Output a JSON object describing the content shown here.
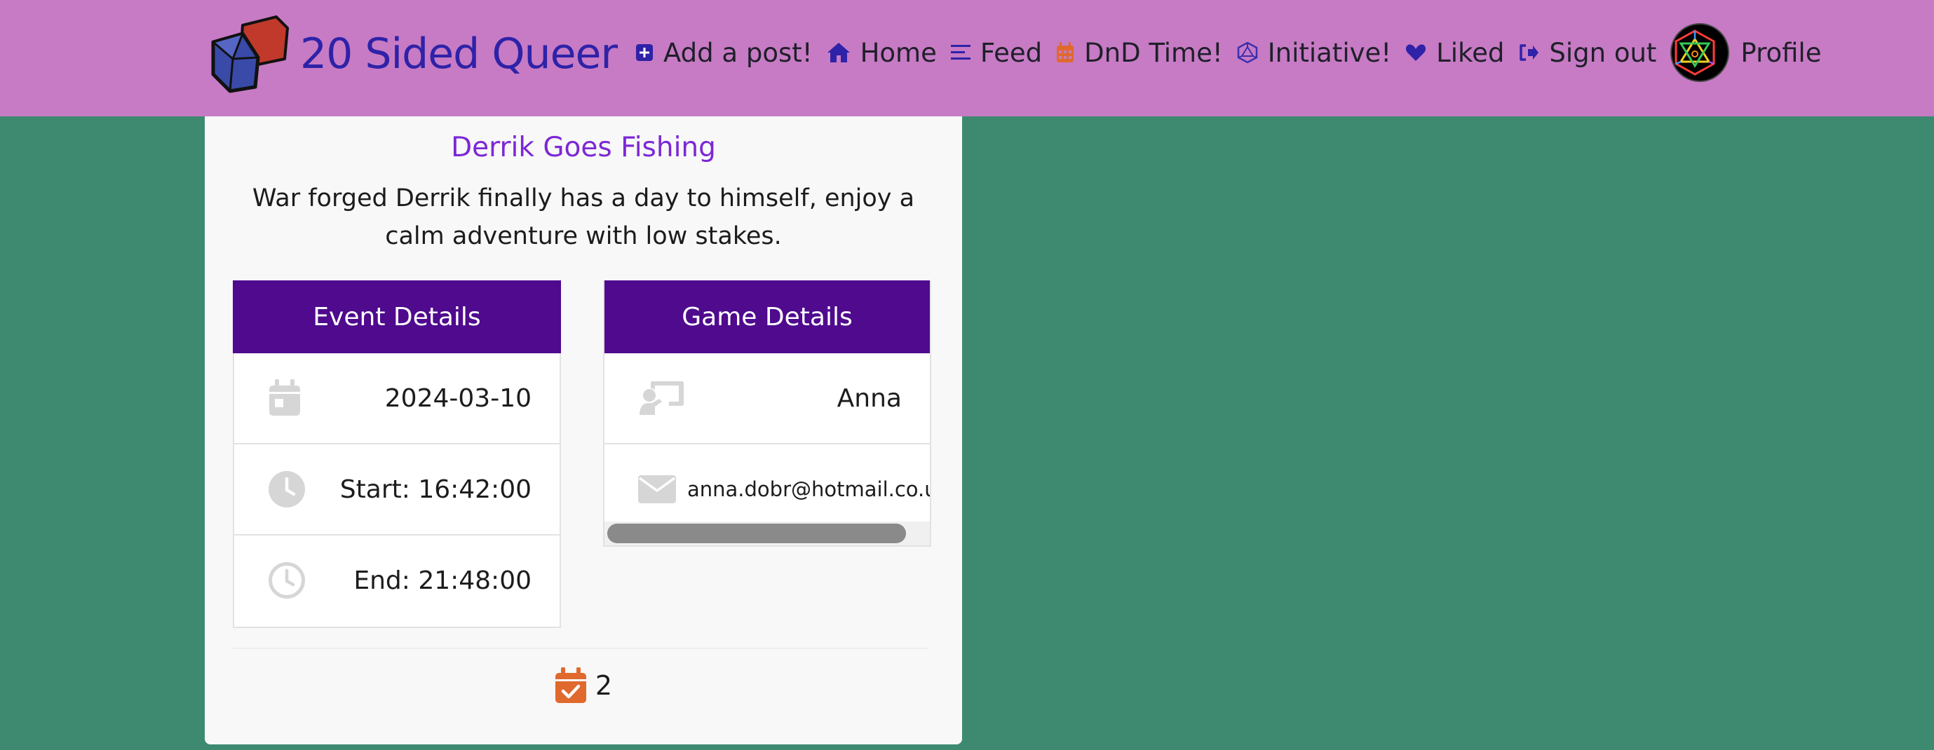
{
  "brand": {
    "name": "20 Sided Queer"
  },
  "nav": {
    "add_post": "Add a post!",
    "home": "Home",
    "feed": "Feed",
    "dnd_time": "DnD Time!",
    "initiative": "Initiative!",
    "liked": "Liked",
    "sign_out": "Sign out",
    "profile": "Profile"
  },
  "icons": {
    "add": "plus-square-icon",
    "home": "house-icon",
    "feed": "list-icon",
    "dnd": "calendar-icon",
    "initiative": "d20-icon",
    "liked": "heart-icon",
    "signout": "sign-out-icon"
  },
  "colors": {
    "navbar": "#c77bc4",
    "brand_text": "#2e22a8",
    "background": "#3d8a70",
    "panel_header": "#4f0a8e",
    "title": "#7d27d6",
    "accent_orange": "#e0692e"
  },
  "event": {
    "title": "Derrik Goes Fishing",
    "description": "War forged Derrik finally has a day to himself, enjoy a calm adventure with low stakes.",
    "details_header": "Event Details",
    "date": "2024-03-10",
    "start": "Start: 16:42:00",
    "end": "End: 21:48:00"
  },
  "game": {
    "details_header": "Game Details",
    "dm": "Anna",
    "email": "anna.dobr@hotmail.co.uk"
  },
  "attendance": {
    "count": "2"
  }
}
